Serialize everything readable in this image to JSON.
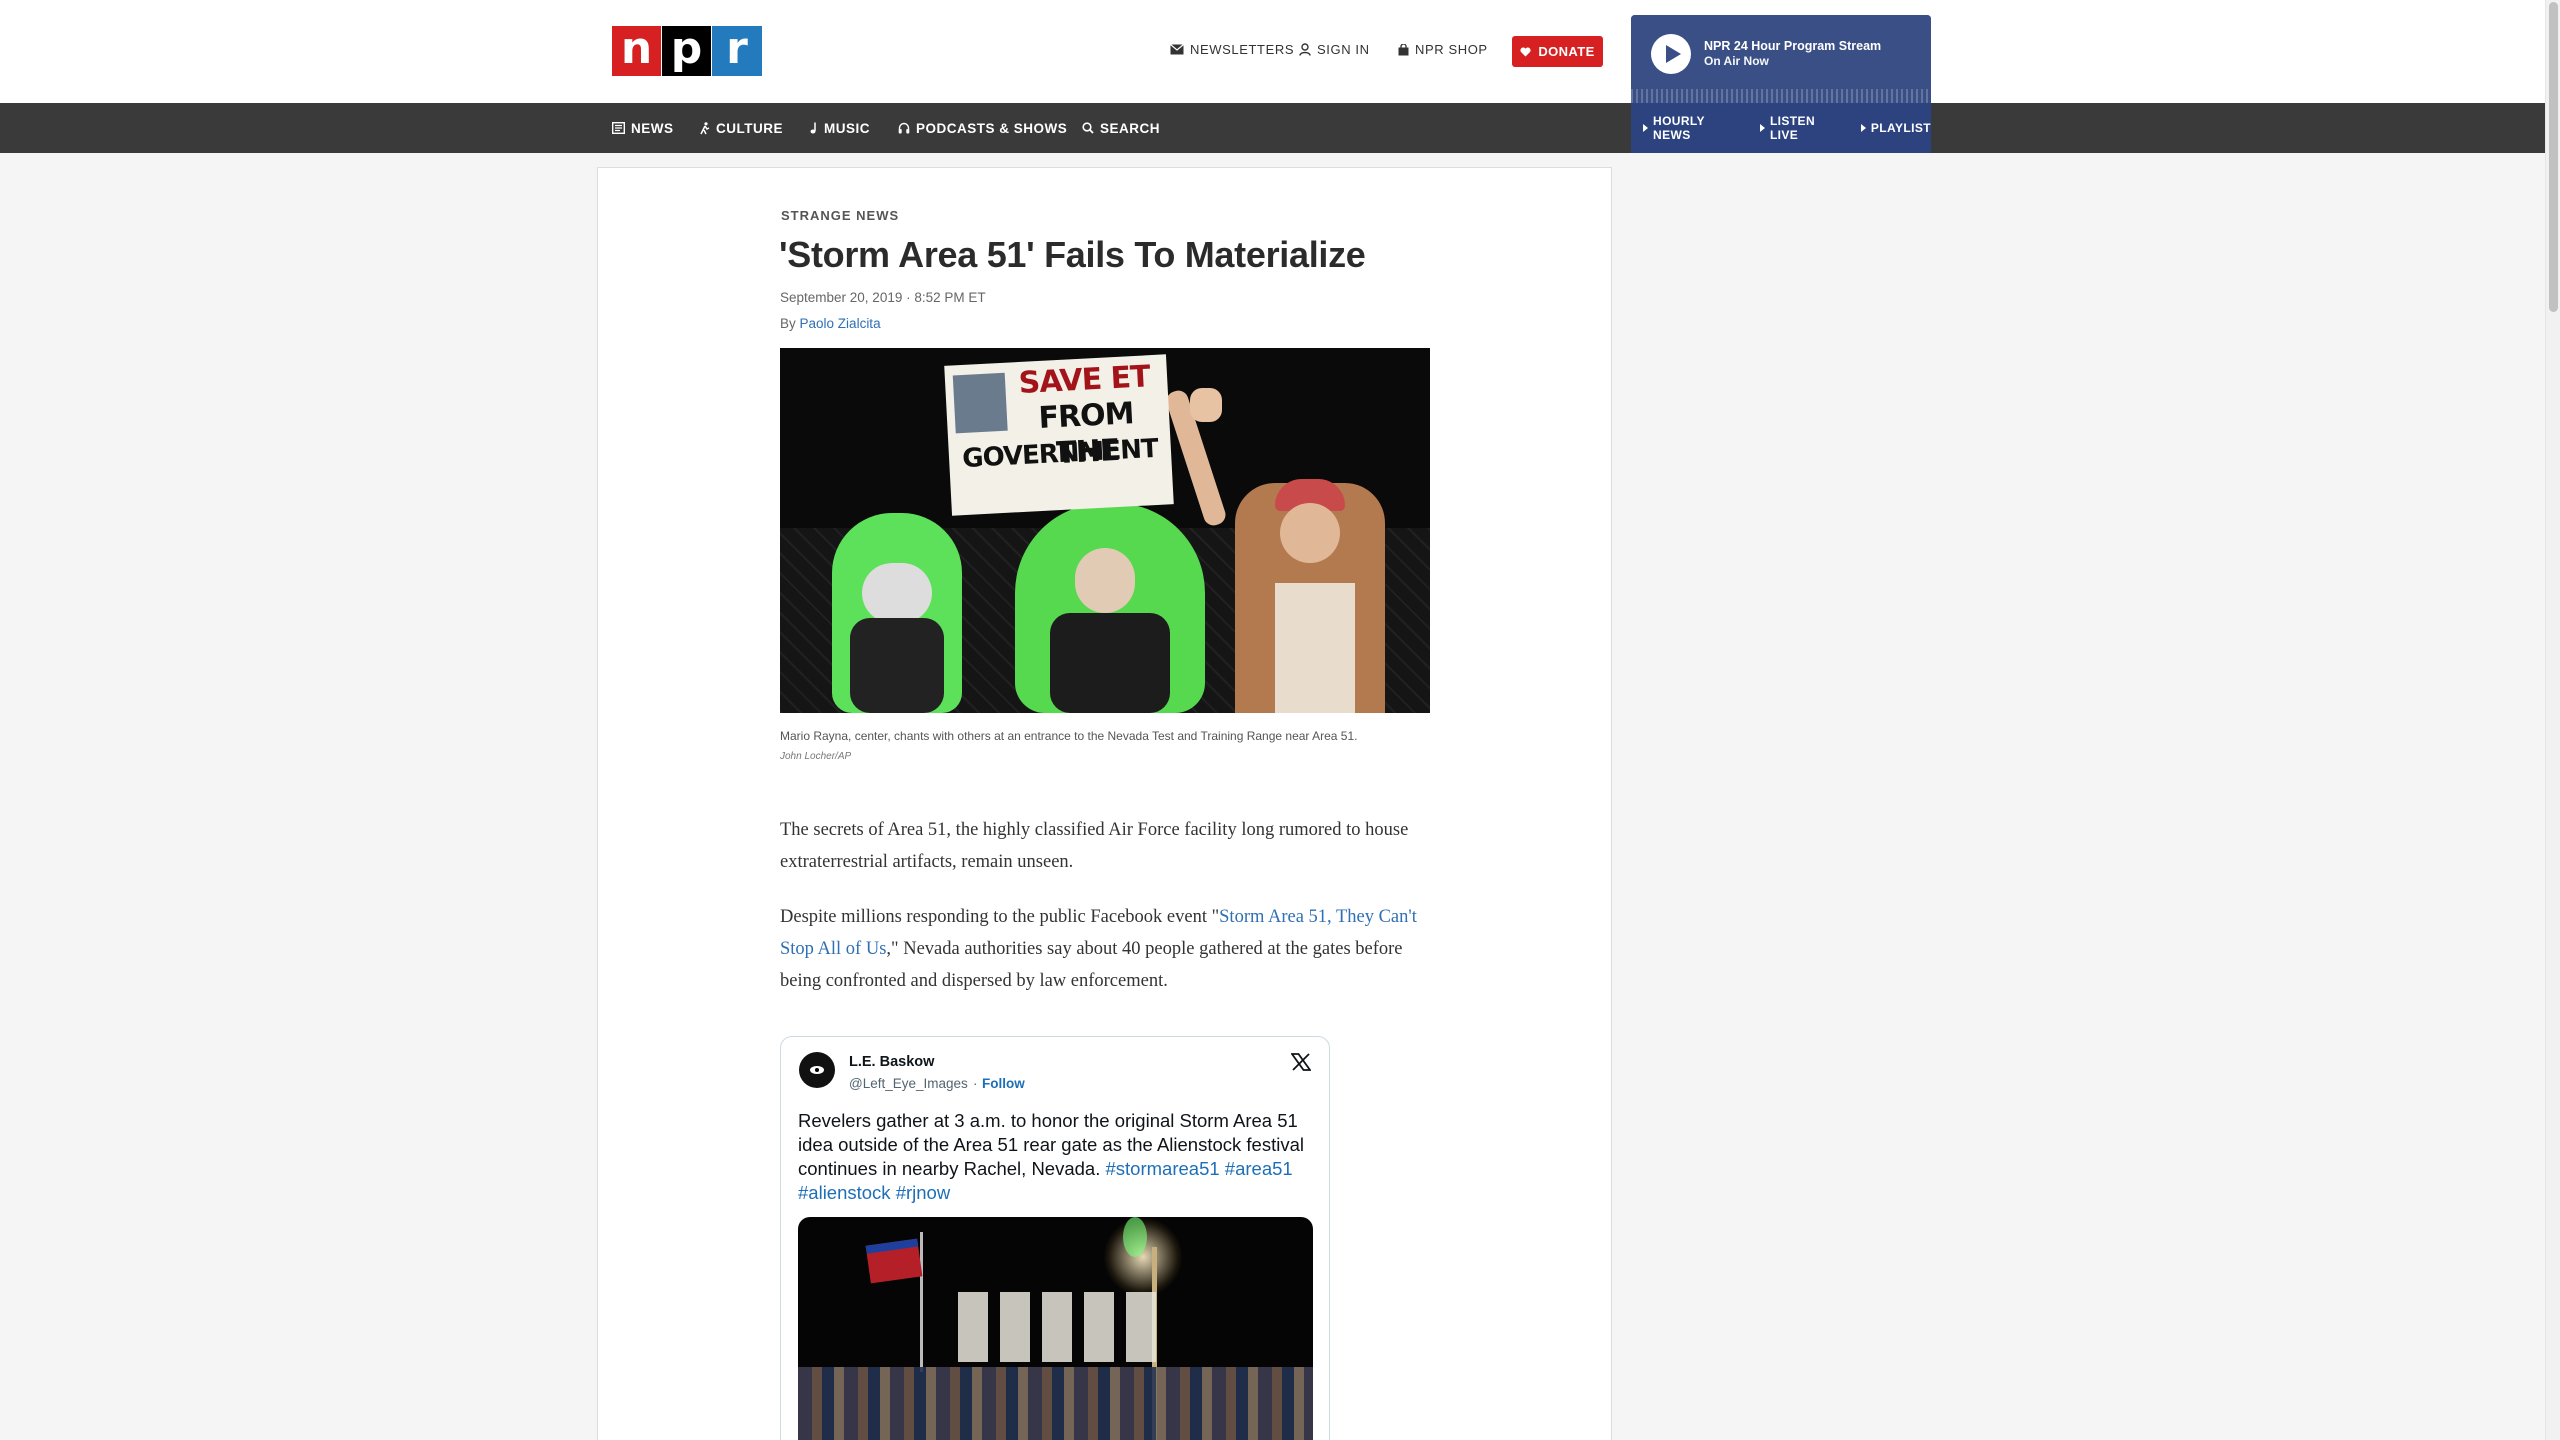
{
  "header": {
    "logo": {
      "letters": [
        "n",
        "p",
        "r"
      ]
    },
    "utility_links": {
      "newsletters": "NEWSLETTERS",
      "sign_in": "SIGN IN",
      "shop": "NPR SHOP"
    },
    "donate_label": "DONATE"
  },
  "nav": {
    "items": [
      {
        "label": "NEWS",
        "icon": "newspaper-icon"
      },
      {
        "label": "CULTURE",
        "icon": "culture-icon"
      },
      {
        "label": "MUSIC",
        "icon": "music-note-icon"
      },
      {
        "label": "PODCASTS & SHOWS",
        "icon": "headphones-icon"
      },
      {
        "label": "SEARCH",
        "icon": "search-icon"
      }
    ]
  },
  "player": {
    "title": "NPR 24 Hour Program Stream",
    "subtitle": "On Air Now",
    "links": [
      "HOURLY NEWS",
      "LISTEN LIVE",
      "PLAYLIST"
    ]
  },
  "article": {
    "section": "STRANGE NEWS",
    "headline": "'Storm Area 51' Fails To Materialize",
    "date": "September 20, 2019 · 8:52 PM ET",
    "byline_prefix": "By",
    "author": "Paolo Zialcita",
    "photo": {
      "sign_line1": "SAVE ET",
      "sign_line2": "FROM THE",
      "sign_line3": "GOVERNMENT",
      "caption": "Mario Rayna, center, chants with others at an entrance to the Nevada Test and Training Range near Area 51.",
      "credit": "John Locher/AP"
    },
    "paragraph1": "The secrets of Area 51, the highly classified Air Force facility long rumored to house extraterrestrial artifacts, remain unseen.",
    "paragraph2_before": "Despite millions responding to the public Facebook event \"",
    "paragraph2_link": "Storm Area 51, They Can't Stop All of Us",
    "paragraph2_after": ",\" Nevada authorities say about 40 people gathered at the gates before being confronted and dispersed by law enforcement."
  },
  "tweet": {
    "name": "L.E. Baskow",
    "handle": "@Left_Eye_Images",
    "separator": "·",
    "follow_label": "Follow",
    "text": "Revelers gather at 3 a.m. to honor the original Storm Area 51 idea outside of the Area 51 rear gate as the Alienstock festival continues in nearby Rachel, Nevada.",
    "hashtags": [
      "#stormarea51",
      "#area51",
      "#alienstock",
      "#rjnow"
    ]
  },
  "colors": {
    "npr_red": "#d62021",
    "npr_blue": "#237bbd",
    "nav_bg": "#3a3a3a",
    "player_bg": "#3a4f86",
    "link": "#2f6fb3"
  }
}
